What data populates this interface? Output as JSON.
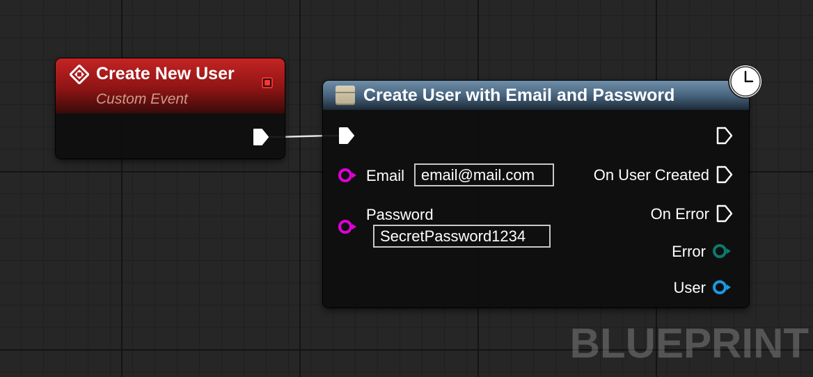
{
  "event_node": {
    "title": "Create New User",
    "subtitle": "Custom Event",
    "icon": "custom-event-icon",
    "header_color": "#b01c1c"
  },
  "function_node": {
    "title": "Create User with Email and Password",
    "icon": "function-icon",
    "latent_icon": "clock-icon",
    "header_color": "#5a7892",
    "inputs": {
      "email": {
        "label": "Email",
        "value": "email@mail.com"
      },
      "password": {
        "label": "Password",
        "value": "SecretPassword1234"
      }
    },
    "outputs": {
      "on_user_created": "On User Created",
      "on_error": "On Error",
      "error": "Error",
      "user": "User"
    }
  },
  "pin_colors": {
    "string": "#e000d8",
    "error": "#0c7a6e",
    "user": "#1a9ae6",
    "exec": "#ffffff"
  },
  "watermark": "BLUEPRINT"
}
